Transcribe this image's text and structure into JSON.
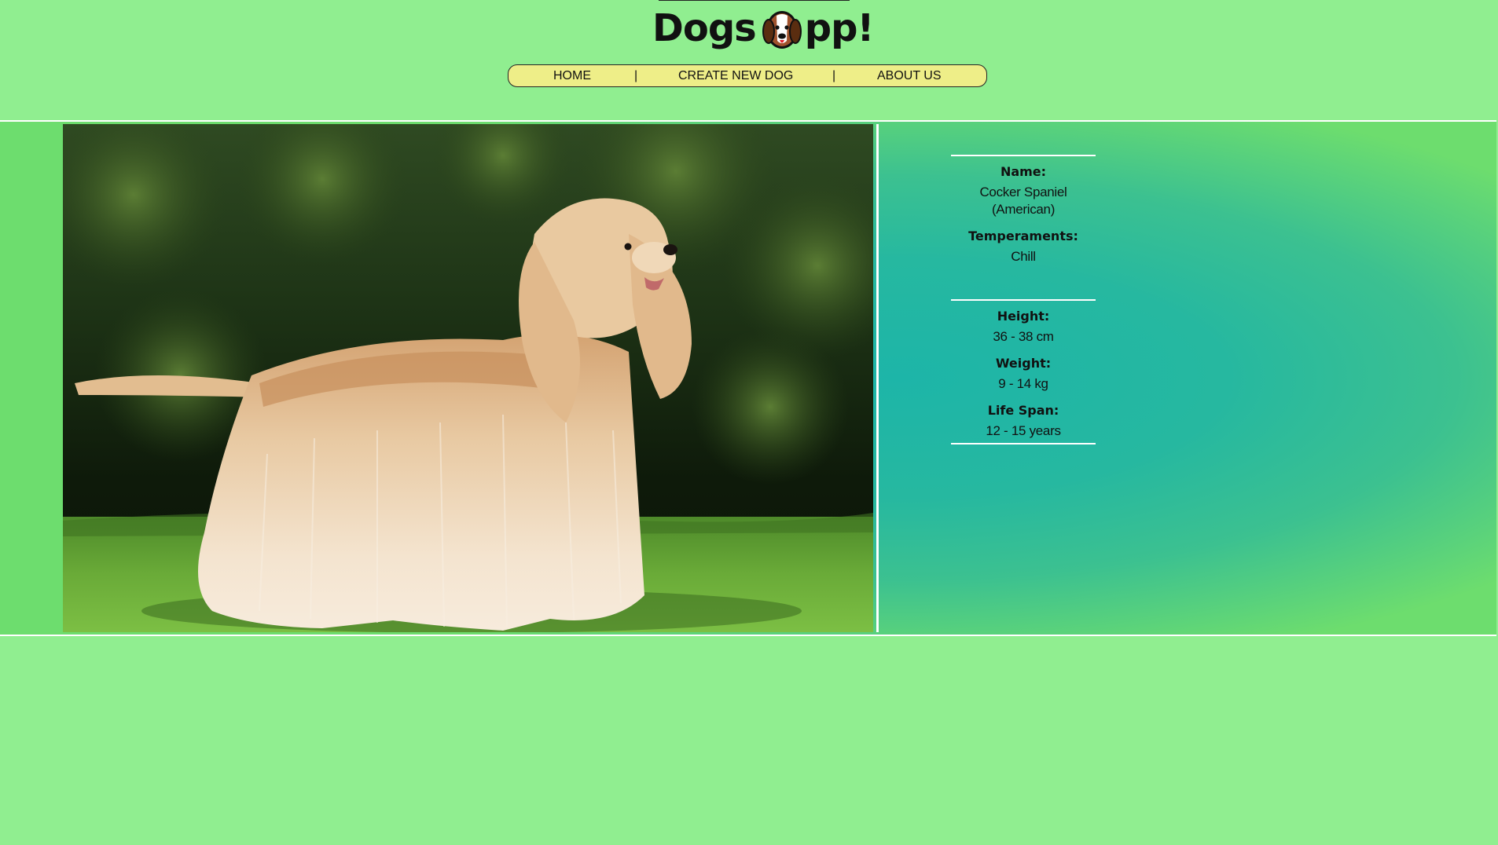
{
  "header": {
    "logo_left": "Dogs",
    "logo_right": "pp!",
    "logo_icon": "dog-face-icon"
  },
  "nav": {
    "home": "HOME",
    "separator_1": "|",
    "create": "CREATE NEW DOG",
    "separator_2": "|",
    "about": "ABOUT US"
  },
  "dog": {
    "name_label": "Name:",
    "name": "Cocker Spaniel (American)",
    "temperaments_label": "Temperaments:",
    "temperaments": "Chill",
    "height_label": "Height:",
    "height": "36 - 38 cm",
    "weight_label": "Weight:",
    "weight": "9 - 14 kg",
    "lifespan_label": "Life Span:",
    "lifespan": "12 - 15 years"
  },
  "colors": {
    "page_background": "#90ee90",
    "nav_background": "#eeee88",
    "panel_center": "#1db5a8",
    "panel_edge": "#6ddd6e",
    "divider": "#ffffff"
  }
}
